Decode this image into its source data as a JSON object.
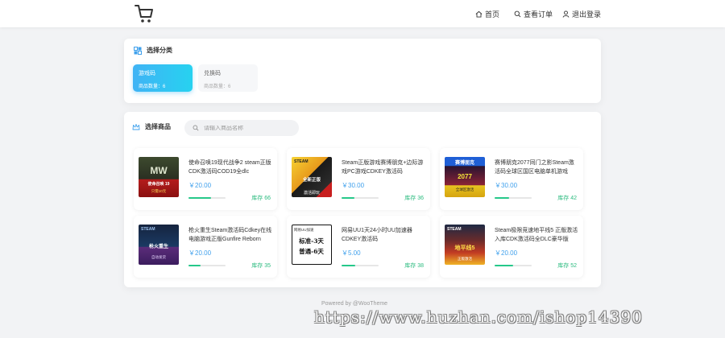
{
  "header": {
    "nav": [
      {
        "label": "首页",
        "icon": "home-icon"
      },
      {
        "label": "查看订单",
        "icon": "search-icon"
      },
      {
        "label": "退出登录",
        "icon": "user-icon"
      }
    ]
  },
  "category_panel": {
    "title": "选择分类",
    "categories": [
      {
        "name": "游戏码",
        "count_label": "商品数量：",
        "count": "6",
        "active": true
      },
      {
        "name": "兑换码",
        "count_label": "商品数量：",
        "count": "6",
        "active": false
      }
    ]
  },
  "product_panel": {
    "title": "选择商品",
    "search": {
      "placeholder": "请输入商品名称",
      "value": ""
    },
    "currency": "￥",
    "stock_label": "库存",
    "products": [
      {
        "title": "使命召唤19现代战争2 steam正版CDK激活码COD19全dlc",
        "price": "20.00",
        "stock": "66",
        "stock_fraction": 0.6
      },
      {
        "title": "Steam正版游戏赛博朋克+边际游戏PC游戏CDKEY激活码",
        "price": "30.00",
        "stock": "36",
        "stock_fraction": 0.35
      },
      {
        "title": "赛博朋克2077同门之影Steam激活码全球区国区电脑单机游戏",
        "price": "30.00",
        "stock": "42",
        "stock_fraction": 0.4
      },
      {
        "title": "枪火重生Steam激活码Cdkey在线电脑游戏正版Gunfire Reborn",
        "price": "20.00",
        "stock": "35",
        "stock_fraction": 0.33
      },
      {
        "title": "网易UU1天24小时UU加速器CDKEY激活码",
        "price": "5.00",
        "stock": "38",
        "stock_fraction": 0.36
      },
      {
        "title": "Steam极限竞速地平线5 正版激活入库CDK激活码全DLC豪华版",
        "price": "20.00",
        "stock": "52",
        "stock_fraction": 0.5
      }
    ]
  },
  "thumbnails": {
    "t1": {
      "line1": "使命召唤 19",
      "line2": "MW",
      "badge": "只需10元"
    },
    "t2": {
      "line1": "STEAM",
      "line2": "全新正版",
      "badge": "激活即玩"
    },
    "t3": {
      "line1": "赛博朋克",
      "line2": "2077",
      "badge": "全球区激活"
    },
    "t4": {
      "line1": "STEAM",
      "line2": "枪火重生",
      "badge": "自动发货"
    },
    "t5": {
      "line1": "标准-3天",
      "line2": "普通-6天",
      "badge": "网易UU加速"
    },
    "t6": {
      "line1": "STEAM",
      "line2": "地平线5",
      "badge": "正版激活"
    }
  },
  "footer": {
    "text": "Powered by @WooTheme"
  },
  "watermark": {
    "text": "https://www.huzhan.com/ishop14390"
  },
  "colors": {
    "accent": "#3fa0ec",
    "stock": "#2bbb7f",
    "active_gradient_start": "#3fb3f5",
    "active_gradient_end": "#27d2f0"
  }
}
